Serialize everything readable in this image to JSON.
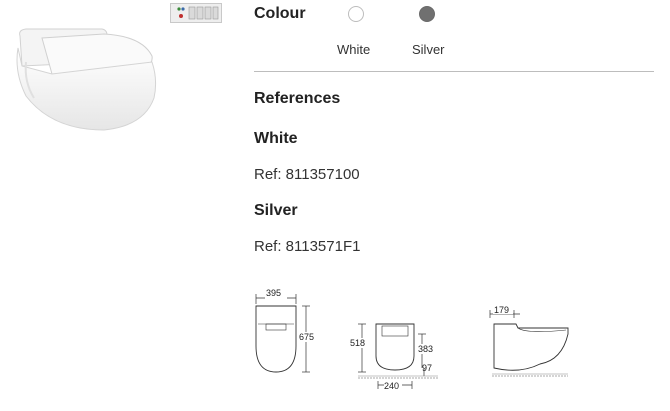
{
  "colour": {
    "heading": "Colour",
    "options": [
      {
        "label": "White",
        "color": "#ffffff"
      },
      {
        "label": "Silver",
        "color": "#707070"
      }
    ]
  },
  "references": {
    "heading": "References",
    "items": [
      {
        "name": "White",
        "ref": "Ref: 811357100"
      },
      {
        "name": "Silver",
        "ref": "Ref: 8113571F1"
      }
    ]
  },
  "drawings": {
    "top_view": {
      "width": "395",
      "length": "675"
    },
    "front_view": {
      "height_total": "518",
      "height_bowl": "383",
      "height_seat": "97",
      "width_base": "240"
    },
    "side_view": {
      "depth": "179"
    }
  }
}
